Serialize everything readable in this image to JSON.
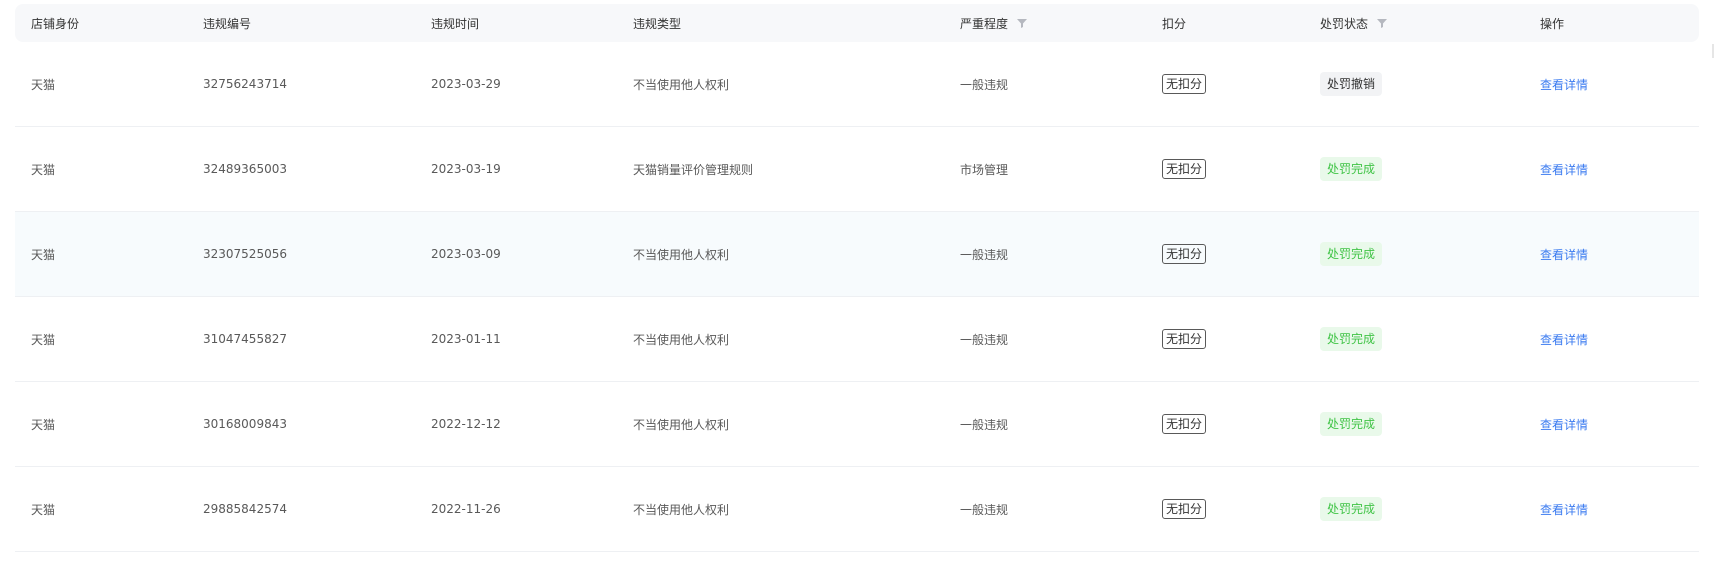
{
  "columns": [
    "店铺身份",
    "违规编号",
    "违规时间",
    "违规类型",
    "严重程度",
    "扣分",
    "处罚状态",
    "操作"
  ],
  "rows": [
    {
      "identity": "天猫",
      "id": "32756243714",
      "date": "2023-03-29",
      "type": "不当使用他人权利",
      "severity": "一般违规",
      "score": "无扣分",
      "status": "处罚撤销",
      "status_kind": "cancelled",
      "action": "查看详情"
    },
    {
      "identity": "天猫",
      "id": "32489365003",
      "date": "2023-03-19",
      "type": "天猫销量评价管理规则",
      "severity": "市场管理",
      "score": "无扣分",
      "status": "处罚完成",
      "status_kind": "done",
      "action": "查看详情"
    },
    {
      "identity": "天猫",
      "id": "32307525056",
      "date": "2023-03-09",
      "type": "不当使用他人权利",
      "severity": "一般违规",
      "score": "无扣分",
      "status": "处罚完成",
      "status_kind": "done",
      "action": "查看详情"
    },
    {
      "identity": "天猫",
      "id": "31047455827",
      "date": "2023-01-11",
      "type": "不当使用他人权利",
      "severity": "一般违规",
      "score": "无扣分",
      "status": "处罚完成",
      "status_kind": "done",
      "action": "查看详情"
    },
    {
      "identity": "天猫",
      "id": "30168009843",
      "date": "2022-12-12",
      "type": "不当使用他人权利",
      "severity": "一般违规",
      "score": "无扣分",
      "status": "处罚完成",
      "status_kind": "done",
      "action": "查看详情"
    },
    {
      "identity": "天猫",
      "id": "29885842574",
      "date": "2022-11-26",
      "type": "不当使用他人权利",
      "severity": "一般违规",
      "score": "无扣分",
      "status": "处罚完成",
      "status_kind": "done",
      "action": "查看详情"
    }
  ],
  "hover_row": 2,
  "icons": {
    "filter": "filter-icon"
  },
  "colors": {
    "link": "#3b7bf0",
    "status_done_text": "#41c447",
    "status_done_bg": "#e9f9ea",
    "status_cancelled_bg": "#f2f3f5",
    "header_bg": "#f7f8fa"
  }
}
